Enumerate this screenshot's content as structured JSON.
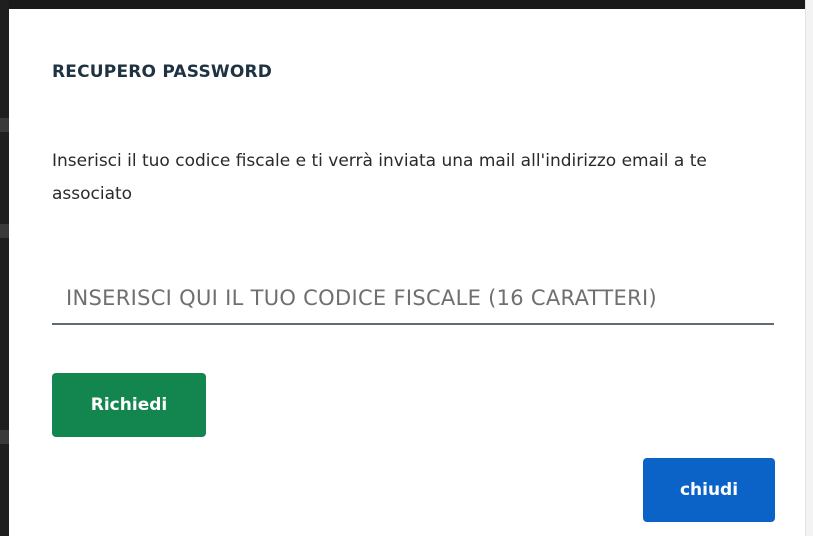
{
  "dialog": {
    "title": "RECUPERO PASSWORD",
    "description": "Inserisci il tuo codice fiscale e ti verrà inviata una mail all'indirizzo email a te associato",
    "codice_fiscale": {
      "value": "",
      "placeholder": "INSERISCI QUI IL TUO CODICE FISCALE (16 CARATTERI)"
    },
    "request_button_label": "Richiedi",
    "close_button_label": "chiudi"
  },
  "colors": {
    "title_text": "#1f3242",
    "request_button": "#138650",
    "close_button": "#0b63c8",
    "input_underline": "#5f6b75"
  }
}
